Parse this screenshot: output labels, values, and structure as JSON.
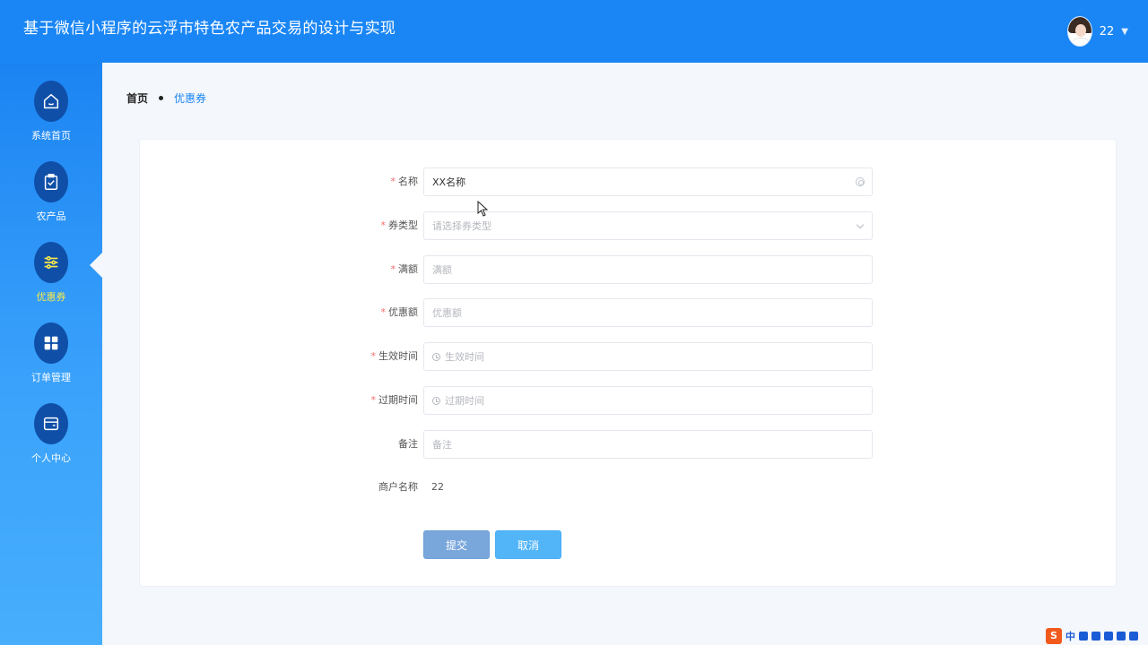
{
  "header": {
    "title": "基于微信小程序的云浮市特色农产品交易的设计与实现",
    "username": "22"
  },
  "sidebar": {
    "items": [
      {
        "label": "系统首页",
        "icon": "home-icon"
      },
      {
        "label": "农产品",
        "icon": "clipboard-check-icon"
      },
      {
        "label": "优惠券",
        "icon": "sliders-icon",
        "active": true
      },
      {
        "label": "订单管理",
        "icon": "grid-icon"
      },
      {
        "label": "个人中心",
        "icon": "wallet-icon"
      }
    ]
  },
  "breadcrumb": {
    "home": "首页",
    "current": "优惠券"
  },
  "form": {
    "name": {
      "label": "名称",
      "value": "XX名称"
    },
    "coupon_type": {
      "label": "券类型",
      "placeholder": "请选择券类型"
    },
    "threshold": {
      "label": "满额",
      "placeholder": "满额"
    },
    "discount": {
      "label": "优惠额",
      "placeholder": "优惠额"
    },
    "start_time": {
      "label": "生效时间",
      "placeholder": "生效时间"
    },
    "end_time": {
      "label": "过期时间",
      "placeholder": "过期时间"
    },
    "remark": {
      "label": "备注",
      "placeholder": "备注"
    },
    "merchant": {
      "label": "商户名称",
      "value": "22"
    },
    "submit_label": "提交",
    "cancel_label": "取消"
  },
  "ime": {
    "logo": "S",
    "mode": "中"
  },
  "colors": {
    "primary": "#1a86f5",
    "active_label": "#f7e94a",
    "required": "#f56c6c",
    "submit": "#79a7dc",
    "cancel": "#52b5f8"
  }
}
